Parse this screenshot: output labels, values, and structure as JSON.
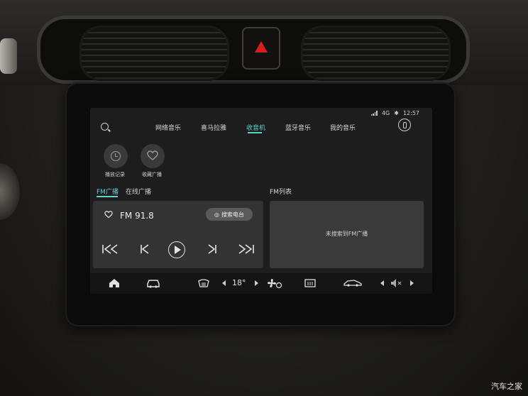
{
  "status_bar": {
    "network": "4G",
    "time": "12:57",
    "icons": [
      "signal-icon",
      "bluetooth-icon"
    ]
  },
  "nav": {
    "tabs": [
      {
        "label": "网络音乐",
        "active": false
      },
      {
        "label": "喜马拉雅",
        "active": false
      },
      {
        "label": "收音机",
        "active": true
      },
      {
        "label": "蓝牙音乐",
        "active": false
      },
      {
        "label": "我的音乐",
        "active": false
      }
    ],
    "accent_color": "#5fd2c9"
  },
  "quick_actions": [
    {
      "label": "播放记录",
      "icon": "history-icon"
    },
    {
      "label": "收藏广播",
      "icon": "heart-icon"
    }
  ],
  "sub_tabs": [
    {
      "label": "FM广播",
      "active": true
    },
    {
      "label": "在线广播",
      "active": false
    }
  ],
  "player": {
    "frequency": "FM 91.8",
    "search_label": "搜索电台",
    "controls": [
      "rewind-icon",
      "previous-icon",
      "play-icon",
      "next-icon",
      "fast-forward-icon"
    ]
  },
  "fm_list": {
    "title": "FM列表",
    "empty_text": "未搜索到FM广播"
  },
  "dock": {
    "temperature": "18°",
    "items": [
      "home-icon",
      "car-icon",
      "defrost-front-icon",
      "fan-icon",
      "defrost-rear-icon",
      "car-settings-icon",
      "volume-mute-icon"
    ]
  },
  "watermark": "汽车之家"
}
